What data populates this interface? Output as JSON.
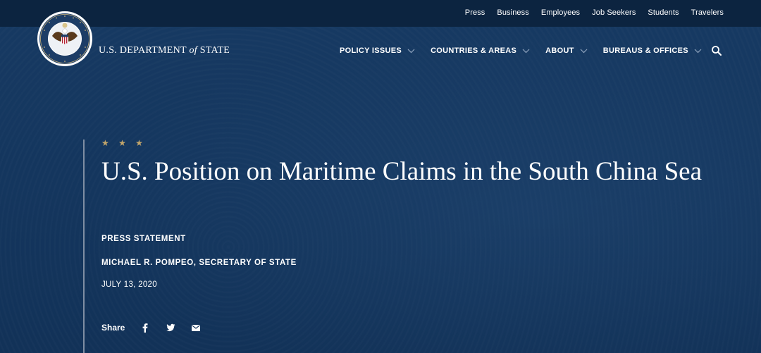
{
  "utility_nav": [
    "Press",
    "Business",
    "Employees",
    "Job Seekers",
    "Students",
    "Travelers"
  ],
  "brand": {
    "prefix": "U.S. DEPARTMENT ",
    "of": "of",
    "suffix": " STATE"
  },
  "main_nav": [
    {
      "label": "POLICY ISSUES"
    },
    {
      "label": "COUNTRIES & AREAS"
    },
    {
      "label": "ABOUT"
    },
    {
      "label": "BUREAUS & OFFICES"
    }
  ],
  "article": {
    "stars": "★ ★ ★",
    "title": "U.S. Position on Maritime Claims in the South China Sea",
    "type": "PRESS STATEMENT",
    "author": "MICHAEL R. POMPEO, SECRETARY OF STATE",
    "date": "JULY 13, 2020"
  },
  "share": {
    "label": "Share",
    "icons": [
      "facebook-icon",
      "twitter-icon",
      "email-icon"
    ]
  },
  "colors": {
    "background": "#13335a",
    "utility_bar": "#0c2440",
    "stars": "#c3a66b",
    "text": "#ffffff"
  }
}
